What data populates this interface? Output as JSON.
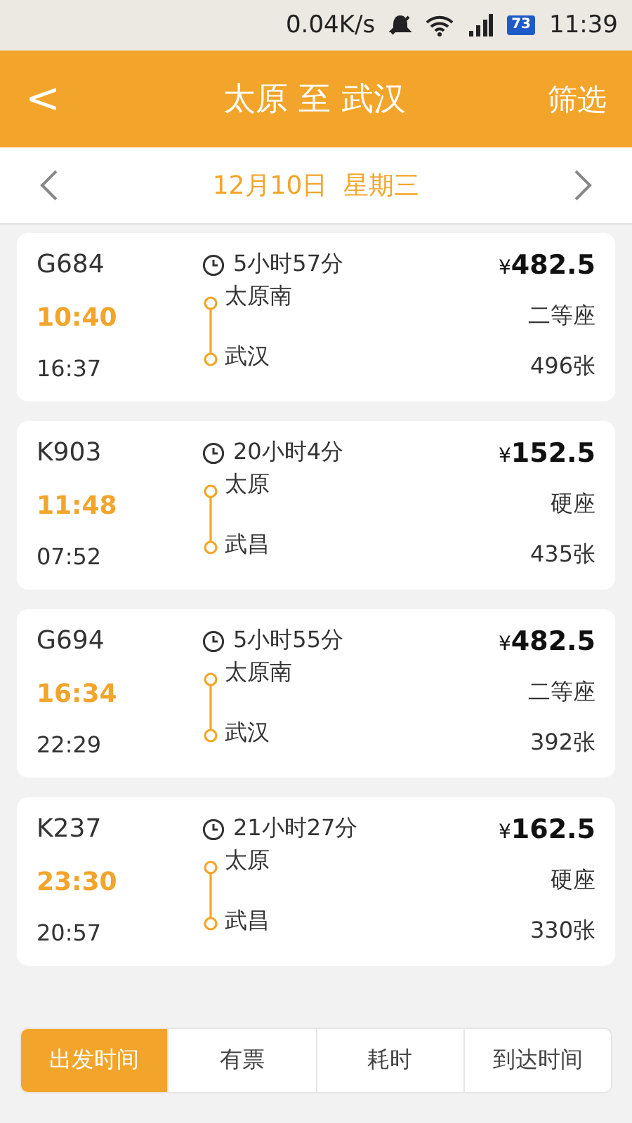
{
  "status_bar": {
    "speed": "0.04K/s",
    "battery": "73",
    "time": "11:39"
  },
  "header": {
    "back": "<",
    "title": "太原 至 武汉",
    "filter": "筛选"
  },
  "date_bar": {
    "date": "12月10日  星期三"
  },
  "trains": [
    {
      "number": "G684",
      "depart": "10:40",
      "arrive": "16:37",
      "duration": "5小时57分",
      "from": "太原南",
      "to": "武汉",
      "price_symbol": "¥",
      "price": "482.5",
      "seat": "二等座",
      "tickets": "496张"
    },
    {
      "number": "K903",
      "depart": "11:48",
      "arrive": "07:52",
      "duration": "20小时4分",
      "from": "太原",
      "to": "武昌",
      "price_symbol": "¥",
      "price": "152.5",
      "seat": "硬座",
      "tickets": "435张"
    },
    {
      "number": "G694",
      "depart": "16:34",
      "arrive": "22:29",
      "duration": "5小时55分",
      "from": "太原南",
      "to": "武汉",
      "price_symbol": "¥",
      "price": "482.5",
      "seat": "二等座",
      "tickets": "392张"
    },
    {
      "number": "K237",
      "depart": "23:30",
      "arrive": "20:57",
      "duration": "21小时27分",
      "from": "太原",
      "to": "武昌",
      "price_symbol": "¥",
      "price": "162.5",
      "seat": "硬座",
      "tickets": "330张"
    }
  ],
  "sort_tabs": [
    {
      "label": "出发时间",
      "selected": true
    },
    {
      "label": "有票",
      "selected": false
    },
    {
      "label": "耗时",
      "selected": false
    },
    {
      "label": "到达时间",
      "selected": false
    }
  ]
}
